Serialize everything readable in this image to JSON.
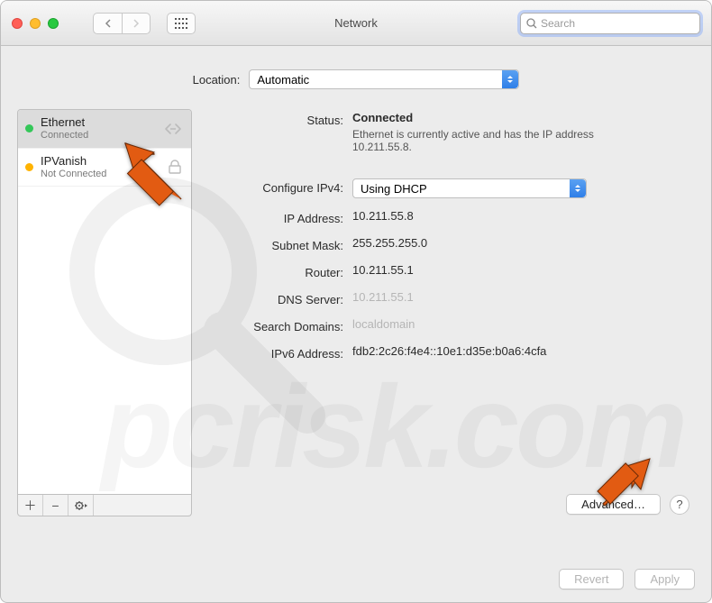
{
  "window": {
    "title": "Network"
  },
  "search": {
    "placeholder": "Search"
  },
  "location": {
    "label": "Location:",
    "value": "Automatic"
  },
  "sidebar": {
    "items": [
      {
        "name": "Ethernet",
        "status": "Connected",
        "dot": "green"
      },
      {
        "name": "IPVanish",
        "status": "Not Connected",
        "dot": "yellow"
      }
    ]
  },
  "details": {
    "status_label": "Status:",
    "status_value": "Connected",
    "status_sub": "Ethernet is currently active and has the IP address 10.211.55.8.",
    "configure_label": "Configure IPv4:",
    "configure_value": "Using DHCP",
    "ip_label": "IP Address:",
    "ip_value": "10.211.55.8",
    "mask_label": "Subnet Mask:",
    "mask_value": "255.255.255.0",
    "router_label": "Router:",
    "router_value": "10.211.55.1",
    "dns_label": "DNS Server:",
    "dns_value": "10.211.55.1",
    "search_label": "Search Domains:",
    "search_value": "localdomain",
    "ipv6_label": "IPv6 Address:",
    "ipv6_value": "fdb2:2c26:f4e4::10e1:d35e:b0a6:4cfa"
  },
  "buttons": {
    "advanced": "Advanced…",
    "help": "?",
    "revert": "Revert",
    "apply": "Apply"
  },
  "footer_icons": {
    "add": "＋",
    "remove": "−",
    "gear": "✱"
  },
  "watermark": "pcrisk.com",
  "colors": {
    "accent": "#2f7fe8",
    "arrow": "#e25b12"
  }
}
